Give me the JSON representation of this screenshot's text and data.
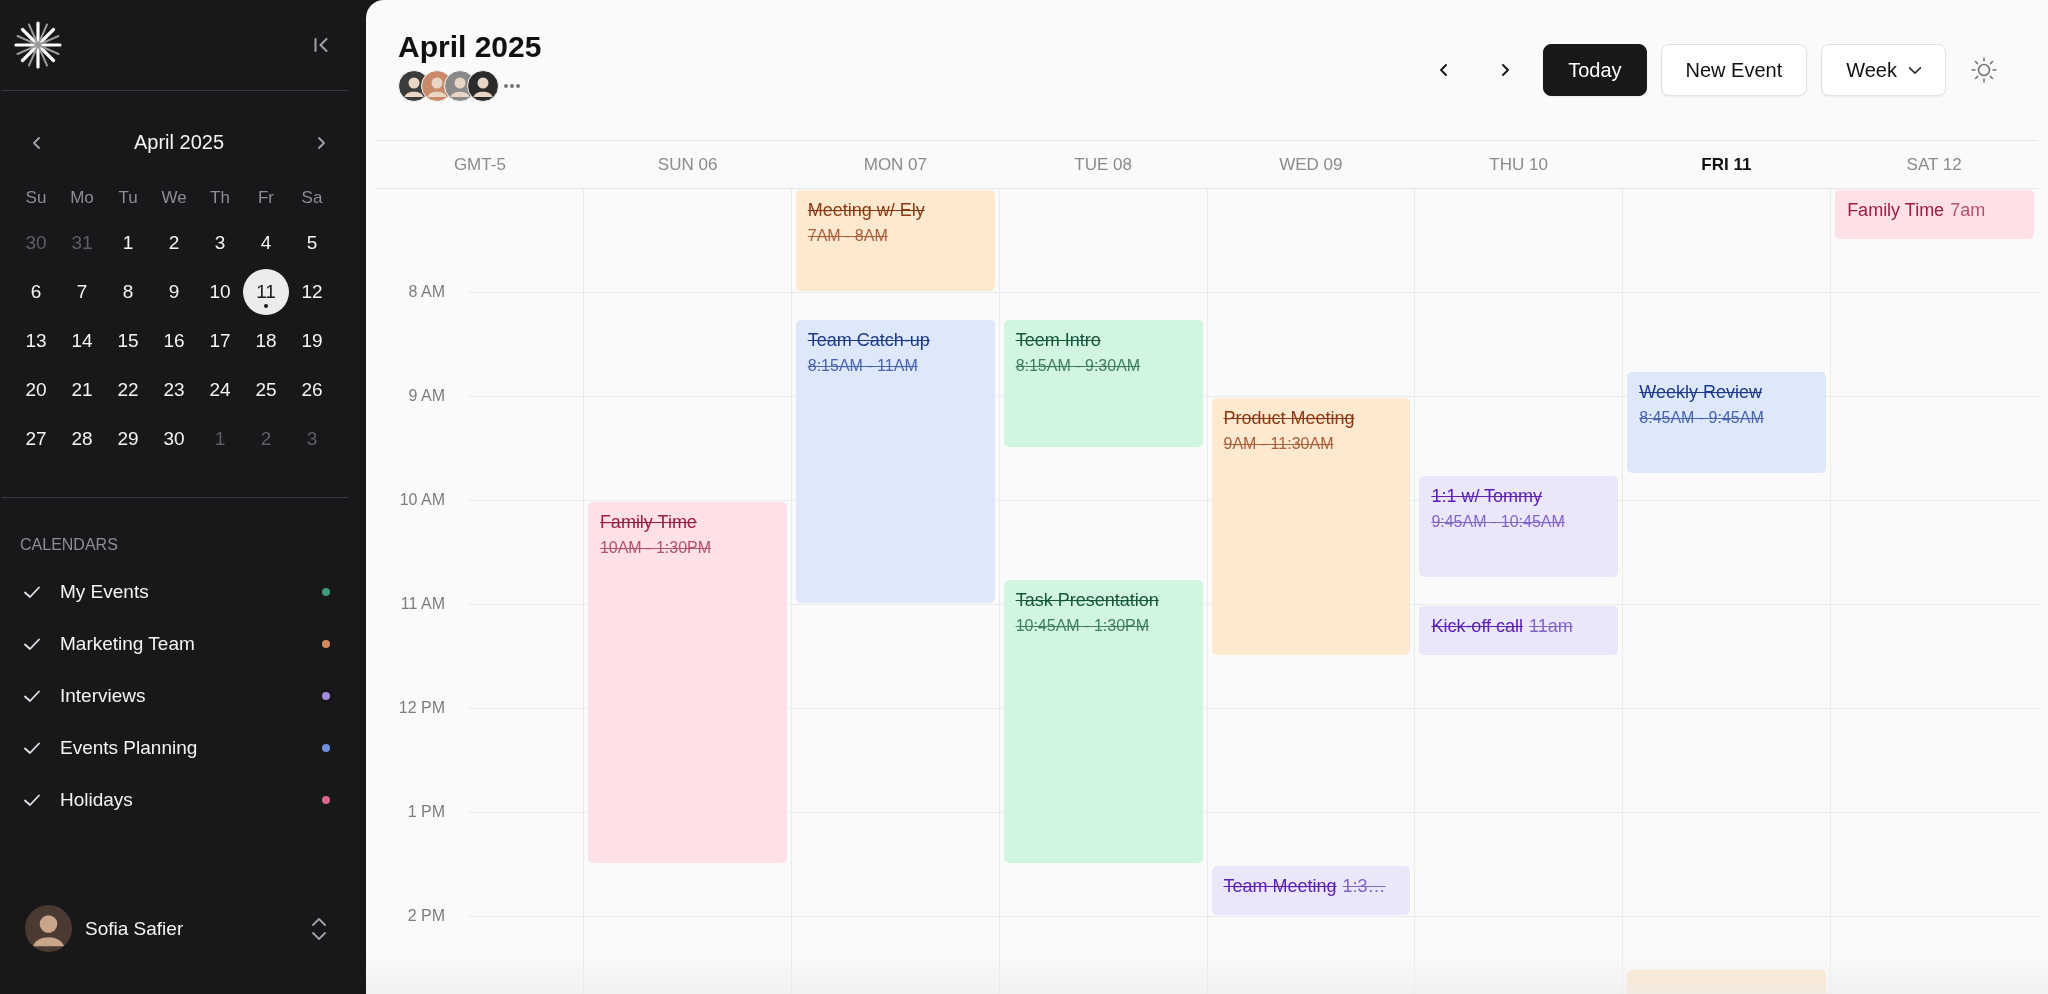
{
  "sidebar": {
    "month": {
      "title": "April 2025"
    },
    "weekdays": [
      "Su",
      "Mo",
      "Tu",
      "We",
      "Th",
      "Fr",
      "Sa"
    ],
    "weeks": [
      [
        {
          "label": "30",
          "muted": true,
          "selected": false
        },
        {
          "label": "31",
          "muted": true,
          "selected": false
        },
        {
          "label": "1",
          "muted": false,
          "selected": false
        },
        {
          "label": "2",
          "muted": false,
          "selected": false
        },
        {
          "label": "3",
          "muted": false,
          "selected": false
        },
        {
          "label": "4",
          "muted": false,
          "selected": false
        },
        {
          "label": "5",
          "muted": false,
          "selected": false
        }
      ],
      [
        {
          "label": "6",
          "muted": false,
          "selected": false
        },
        {
          "label": "7",
          "muted": false,
          "selected": false
        },
        {
          "label": "8",
          "muted": false,
          "selected": false
        },
        {
          "label": "9",
          "muted": false,
          "selected": false
        },
        {
          "label": "10",
          "muted": false,
          "selected": false
        },
        {
          "label": "11",
          "muted": false,
          "selected": true
        },
        {
          "label": "12",
          "muted": false,
          "selected": false
        }
      ],
      [
        {
          "label": "13",
          "muted": false,
          "selected": false
        },
        {
          "label": "14",
          "muted": false,
          "selected": false
        },
        {
          "label": "15",
          "muted": false,
          "selected": false
        },
        {
          "label": "16",
          "muted": false,
          "selected": false
        },
        {
          "label": "17",
          "muted": false,
          "selected": false
        },
        {
          "label": "18",
          "muted": false,
          "selected": false
        },
        {
          "label": "19",
          "muted": false,
          "selected": false
        }
      ],
      [
        {
          "label": "20",
          "muted": false,
          "selected": false
        },
        {
          "label": "21",
          "muted": false,
          "selected": false
        },
        {
          "label": "22",
          "muted": false,
          "selected": false
        },
        {
          "label": "23",
          "muted": false,
          "selected": false
        },
        {
          "label": "24",
          "muted": false,
          "selected": false
        },
        {
          "label": "25",
          "muted": false,
          "selected": false
        },
        {
          "label": "26",
          "muted": false,
          "selected": false
        }
      ],
      [
        {
          "label": "27",
          "muted": false,
          "selected": false
        },
        {
          "label": "28",
          "muted": false,
          "selected": false
        },
        {
          "label": "29",
          "muted": false,
          "selected": false
        },
        {
          "label": "30",
          "muted": false,
          "selected": false
        },
        {
          "label": "1",
          "muted": true,
          "selected": false
        },
        {
          "label": "2",
          "muted": true,
          "selected": false
        },
        {
          "label": "3",
          "muted": true,
          "selected": false
        }
      ]
    ],
    "calendars_heading": "CALENDARS",
    "calendars": [
      {
        "name": "My Events",
        "checked": true,
        "color": "#3f9e7a"
      },
      {
        "name": "Marketing Team",
        "checked": true,
        "color": "#d08a5c"
      },
      {
        "name": "Interviews",
        "checked": true,
        "color": "#a78bda"
      },
      {
        "name": "Events Planning",
        "checked": true,
        "color": "#6f8fdc"
      },
      {
        "name": "Holidays",
        "checked": true,
        "color": "#d9678a"
      }
    ],
    "user": {
      "name": "Sofia Safier"
    }
  },
  "header": {
    "title": "April 2025",
    "buttons": {
      "today": "Today",
      "new_event": "New Event"
    },
    "view": "Week"
  },
  "timezone": "GMT-5",
  "hours": [
    "8 AM",
    "9 AM",
    "10 AM",
    "11 AM",
    "12 PM",
    "1 PM",
    "2 PM"
  ],
  "days": [
    {
      "label": "SUN 06",
      "selected": false,
      "events": [
        {
          "title": "Family Time",
          "time": "10AM - 1:30PM",
          "kind": "block",
          "done": true,
          "color": "#fde1e6"
        }
      ]
    },
    {
      "label": "MON 07",
      "selected": false,
      "events": [
        {
          "title": "Meeting w/ Ely",
          "time": "7AM - 8AM",
          "kind": "block",
          "done": true,
          "color": "#fde8d0"
        },
        {
          "title": "Team Catch-up",
          "time": "8:15AM - 11AM",
          "kind": "block",
          "done": true,
          "color": "#dde9fb"
        }
      ]
    },
    {
      "label": "TUE 08",
      "selected": false,
      "events": [
        {
          "title": "Teem Intro",
          "time": "8:15AM - 9:30AM",
          "kind": "block",
          "done": true,
          "color": "#d1f5e1"
        },
        {
          "title": "Task Presentation",
          "time": "10:45AM - 1:30PM",
          "kind": "block",
          "done": true,
          "color": "#d1f5e1"
        }
      ]
    },
    {
      "label": "WED 09",
      "selected": false,
      "events": [
        {
          "title": "Product Meeting",
          "time": "9AM - 11:30AM",
          "kind": "block",
          "done": true,
          "color": "#fde8d0"
        },
        {
          "title": "Team Meeting",
          "time": "1:3…",
          "kind": "inline",
          "done": true,
          "color": "#ebe7fb"
        }
      ]
    },
    {
      "label": "THU 10",
      "selected": false,
      "events": [
        {
          "title": "1:1 w/ Tommy",
          "time": "9:45AM - 10:45AM",
          "kind": "block",
          "done": true,
          "color": "#ebe7fb"
        },
        {
          "title": "Kick-off call",
          "time": "11am",
          "kind": "inline",
          "done": true,
          "color": "#ebe7fb"
        }
      ]
    },
    {
      "label": "FRI 11",
      "selected": true,
      "events": [
        {
          "title": "Weekly Review",
          "time": "8:45AM - 9:45AM",
          "kind": "block",
          "done": true,
          "color": "#dde9fb"
        },
        {
          "kind": "block",
          "color": "#fde8d0"
        }
      ]
    },
    {
      "label": "SAT 12",
      "selected": false,
      "events": [
        {
          "title": "Family Time",
          "time": "7am",
          "kind": "inline",
          "done": false,
          "color": "#fde1e6"
        }
      ]
    }
  ]
}
